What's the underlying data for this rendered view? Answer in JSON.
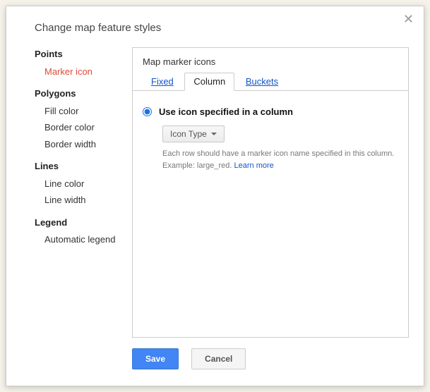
{
  "dialog": {
    "title": "Change map feature styles"
  },
  "sidebar": {
    "groups": [
      {
        "head": "Points",
        "items": [
          {
            "label": "Marker icon",
            "active": true
          }
        ]
      },
      {
        "head": "Polygons",
        "items": [
          {
            "label": "Fill color"
          },
          {
            "label": "Border color"
          },
          {
            "label": "Border width"
          }
        ]
      },
      {
        "head": "Lines",
        "items": [
          {
            "label": "Line color"
          },
          {
            "label": "Line width"
          }
        ]
      },
      {
        "head": "Legend",
        "items": [
          {
            "label": "Automatic legend"
          }
        ]
      }
    ]
  },
  "panel": {
    "title": "Map marker icons",
    "tabs": {
      "fixed": "Fixed",
      "column": "Column",
      "buckets": "Buckets"
    },
    "option": {
      "radio_label": "Use icon specified in a column",
      "dropdown_label": "Icon Type",
      "help_line1": "Each row should have a marker icon name specified in this column.",
      "help_line2_prefix": "Example: large_red.  ",
      "learn_more": "Learn more"
    }
  },
  "buttons": {
    "save": "Save",
    "cancel": "Cancel"
  }
}
